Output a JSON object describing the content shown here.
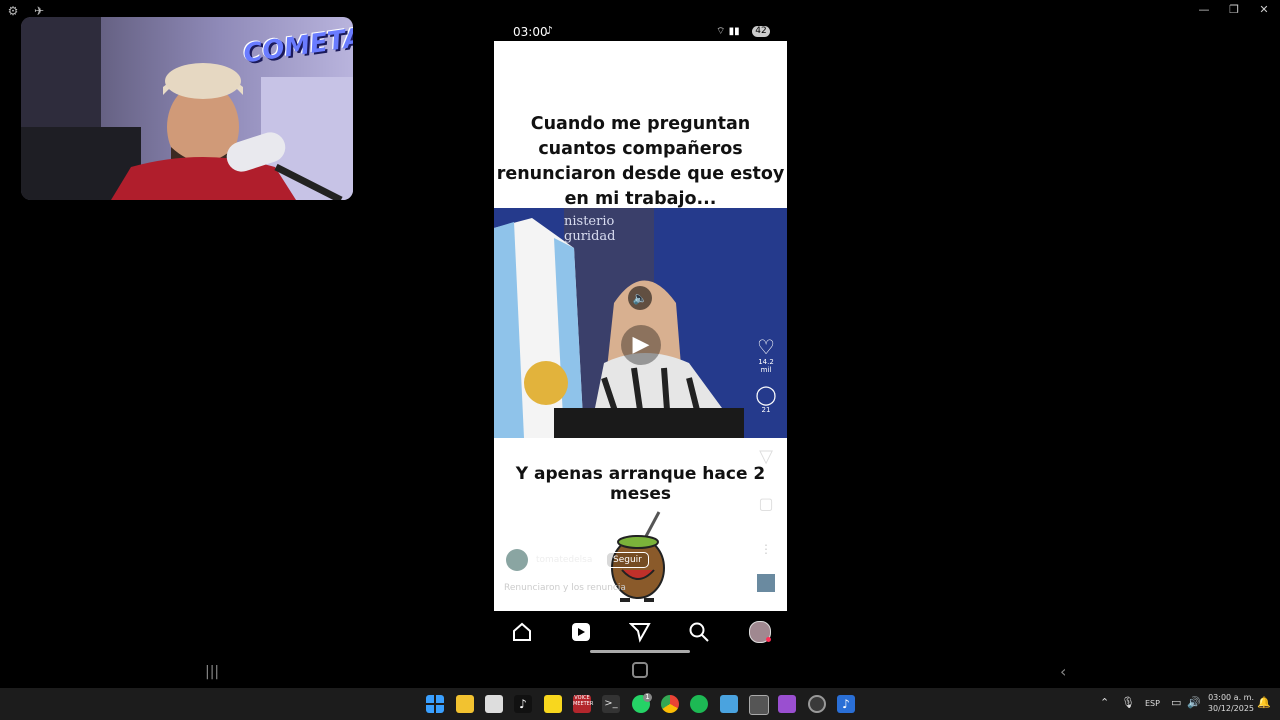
{
  "phone": {
    "status": {
      "time": "03:00",
      "battery": "42"
    },
    "post1": {
      "caption": "Cuando me preguntan cuantos compañeros renunciaron desde que estoy en mi trabajo...",
      "sign_line1": "nisterio",
      "sign_line2": "guridad",
      "likes": "14.2 mil",
      "comments": "21"
    },
    "post2": {
      "caption": "Y apenas arranque hace 2 meses",
      "username": "tomatedelsa",
      "follow_label": "Seguir",
      "description": "Renunciaron y los renuncia"
    },
    "nav": [
      "home-icon",
      "reels-icon",
      "send-icon",
      "search-icon",
      "profile-avatar"
    ]
  },
  "webcam": {
    "overlay_text": "COMETA"
  },
  "system_tray": {
    "language": "ESP",
    "time": "03:00 a. m.",
    "date": "30/12/2025"
  },
  "taskbar": {
    "apps": [
      "start",
      "file-explorer",
      "store",
      "tiktok",
      "sticky-notes",
      "voicemeeter",
      "terminal",
      "whatsapp",
      "chrome",
      "spotify",
      "app-grid",
      "window-app",
      "phone-link",
      "obs",
      "scrcpy"
    ],
    "whatsapp_badge": "1",
    "voicemeeter_label": "VOICE\nMEETER"
  },
  "colors": {
    "instagram_accent": "#ff2d55",
    "taskbar_bg": "#1c1c1c",
    "video_blue": "#2a3f8f"
  }
}
